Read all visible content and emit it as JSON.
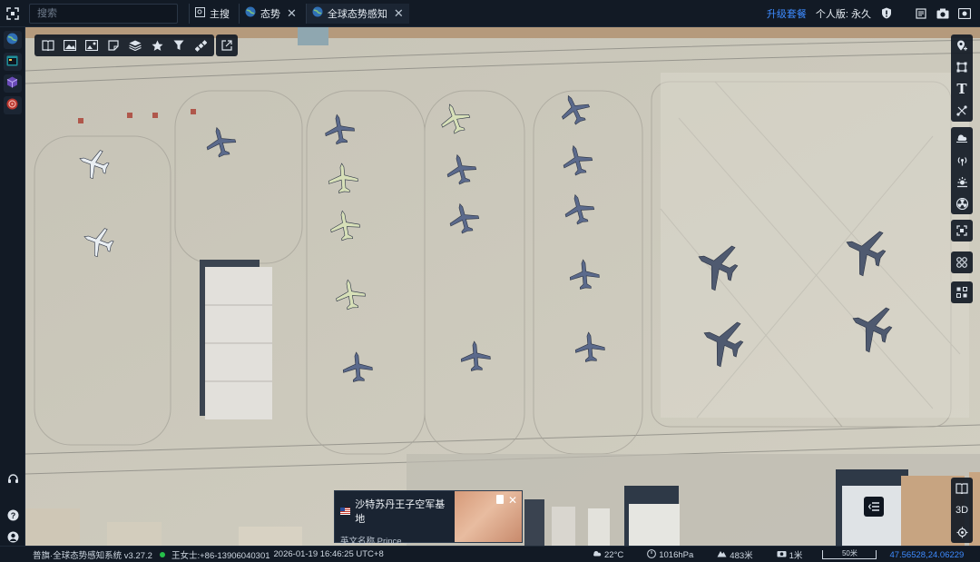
{
  "search": {
    "placeholder": "搜索"
  },
  "tabs": [
    {
      "label": "主搜",
      "icon": "search-frame-icon",
      "closable": false
    },
    {
      "label": "态势",
      "icon": "globe-icon",
      "closable": true
    },
    {
      "label": "全球态势感知",
      "icon": "globe-icon",
      "closable": true,
      "active": true
    }
  ],
  "header": {
    "upgrade_label": "升级套餐",
    "user_label": "个人版: 永久"
  },
  "popup": {
    "title": "沙特苏丹王子空军基地",
    "subtitle": "英文名称 Prince ..."
  },
  "right_tools": {
    "text_label": "T",
    "threed_label": "3D"
  },
  "status": {
    "app": "普旗·全球态势感知系统 v3.27.2",
    "user": "王女士:+86-13906040301",
    "datetime": "2026-01-19 16:46:25 UTC+8",
    "temperature": "22°C",
    "pressure": "1016hPa",
    "altitude": "483米",
    "resolution": "1米",
    "scale": "50米",
    "coords": "47.56528,24.06229"
  },
  "colors": {
    "accent": "#3d8bff",
    "online": "#26c04a",
    "panel": "#121a25"
  }
}
